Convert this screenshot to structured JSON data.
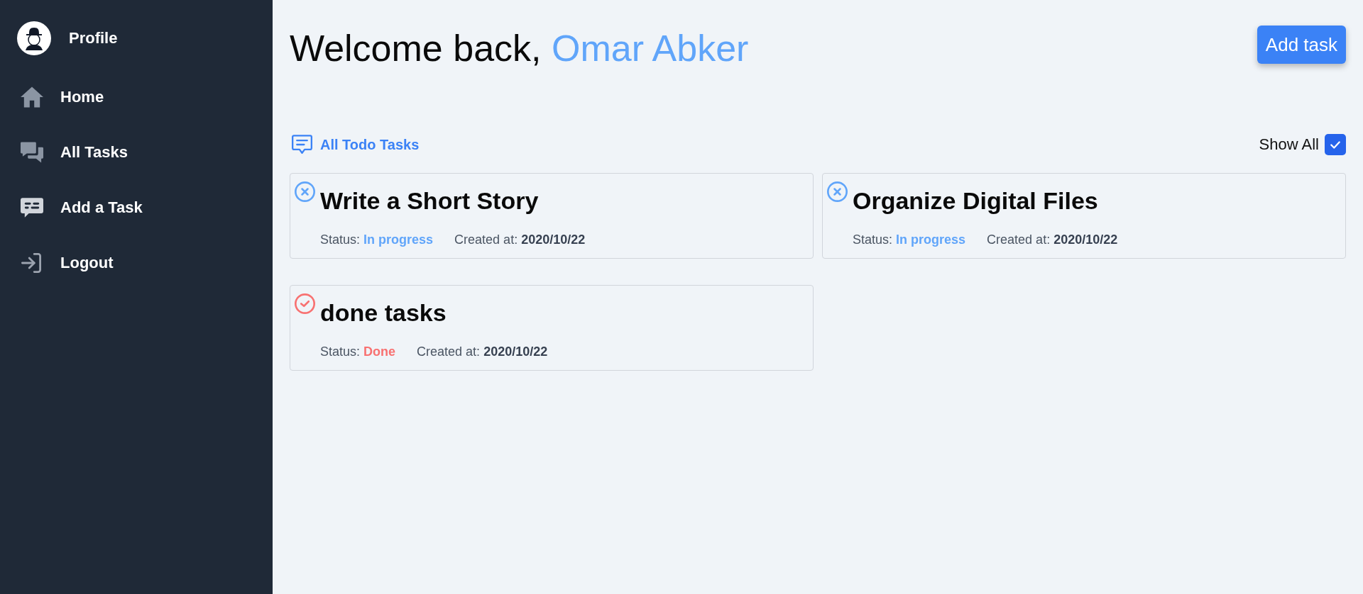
{
  "sidebar": {
    "profile": {
      "label": "Profile"
    },
    "items": [
      {
        "label": "Home"
      },
      {
        "label": "All Tasks"
      },
      {
        "label": "Add a Task"
      },
      {
        "label": "Logout"
      }
    ]
  },
  "header": {
    "greeting": "Welcome back,",
    "user_name": "Omar Abker",
    "add_button": "Add task"
  },
  "tasks_section": {
    "title": "All Todo Tasks",
    "show_all": {
      "label": "Show All",
      "checked": true
    }
  },
  "tasks": [
    {
      "title": "Write a Short Story",
      "status_label": "Status:",
      "status": "In progress",
      "done": false,
      "created_label": "Created at:",
      "created_at": "2020/10/22"
    },
    {
      "title": "Organize Digital Files",
      "status_label": "Status:",
      "status": "In progress",
      "done": false,
      "created_label": "Created at:",
      "created_at": "2020/10/22"
    },
    {
      "title": "done tasks",
      "status_label": "Status:",
      "status": "Done",
      "done": true,
      "created_label": "Created at:",
      "created_at": "2020/10/22"
    }
  ]
}
